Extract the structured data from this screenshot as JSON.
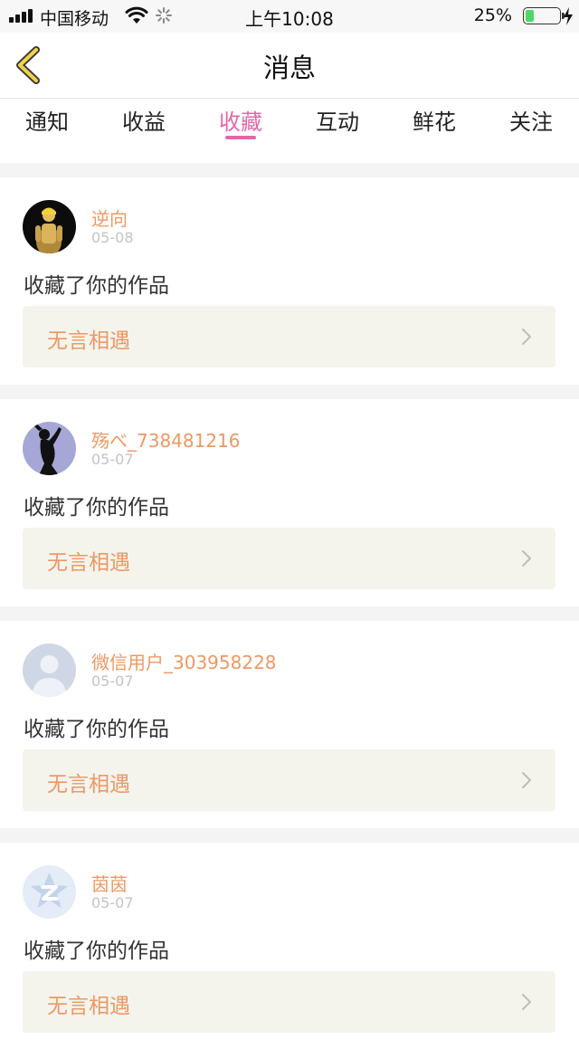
{
  "status_bar": {
    "carrier": "中国移动",
    "time": "上午10:08",
    "battery_percent": "25%",
    "battery_level": 0.25,
    "battery_color": "#4cd964"
  },
  "nav": {
    "title": "消息",
    "back_icon": "chevron-left-icon"
  },
  "tabs": [
    {
      "label": "通知",
      "active": false
    },
    {
      "label": "收益",
      "active": false
    },
    {
      "label": "收藏",
      "active": true
    },
    {
      "label": "互动",
      "active": false
    },
    {
      "label": "鲜花",
      "active": false
    },
    {
      "label": "关注",
      "active": false
    }
  ],
  "colors": {
    "accent": "#e567a6",
    "username": "#ee9864",
    "work_bg": "#f4f4ed"
  },
  "messages": [
    {
      "user": "逆向",
      "date": "05-08",
      "action": "收藏了你的作品",
      "work": "无言相遇",
      "avatar": "golden-figure-avatar"
    },
    {
      "user": "殇べ_738481216",
      "date": "05-07",
      "action": "收藏了你的作品",
      "work": "无言相遇",
      "avatar": "silhouette-avatar"
    },
    {
      "user": "微信用户_303958228",
      "date": "05-07",
      "action": "收藏了你的作品",
      "work": "无言相遇",
      "avatar": "default-user-avatar"
    },
    {
      "user": "茵茵",
      "date": "05-07",
      "action": "收藏了你的作品",
      "work": "无言相遇",
      "avatar": "qq-default-avatar"
    }
  ]
}
